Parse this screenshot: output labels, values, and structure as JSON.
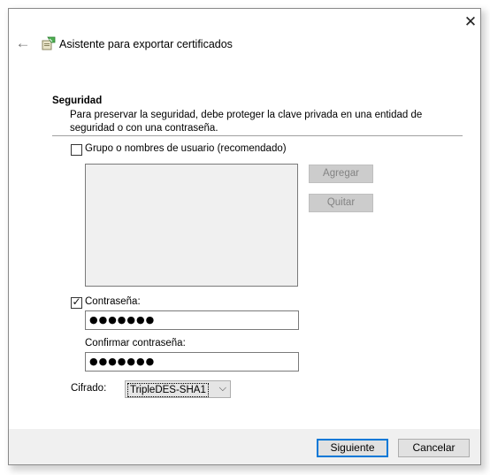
{
  "window": {
    "title": "Asistente para exportar certificados",
    "close_glyph": "✕",
    "back_glyph": "←"
  },
  "security": {
    "heading": "Seguridad",
    "description": "Para preservar la seguridad, debe proteger la clave privada en una entidad de seguridad o con una contraseña.",
    "group_option": {
      "label": "Grupo o nombres de usuario (recomendado)",
      "checked": false
    },
    "add_button": "Agregar",
    "remove_button": "Quitar",
    "password_option": {
      "label": "Contraseña:",
      "checked": true,
      "check_glyph": "✓"
    },
    "password_value": "●●●●●●●",
    "confirm_label": "Confirmar contraseña:",
    "confirm_value": "●●●●●●●",
    "encryption_label": "Cifrado:",
    "encryption_value": "TripleDES-SHA1",
    "dropdown_glyph": "⌵"
  },
  "footer": {
    "next_button": "Siguiente",
    "cancel_button": "Cancelar"
  },
  "colors": {
    "accent": "#0078d7",
    "footer_bg": "#f0f0f0",
    "disabled_button_bg": "#cccccc"
  }
}
